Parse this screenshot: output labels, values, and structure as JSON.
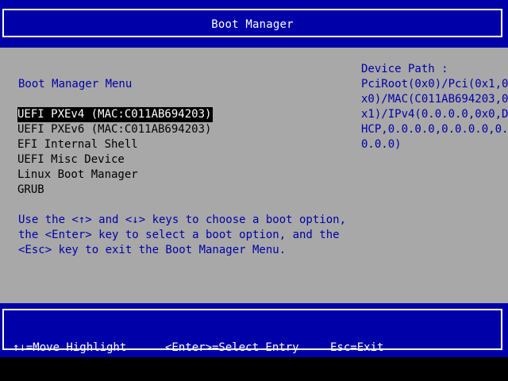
{
  "header": {
    "title": "Boot Manager"
  },
  "menu": {
    "heading": "Boot Manager Menu",
    "items": [
      {
        "label": "UEFI PXEv4 (MAC:C011AB694203)",
        "selected": true
      },
      {
        "label": "UEFI PXEv6 (MAC:C011AB694203)",
        "selected": false
      },
      {
        "label": "EFI Internal Shell",
        "selected": false
      },
      {
        "label": "UEFI Misc Device",
        "selected": false
      },
      {
        "label": "Linux Boot Manager",
        "selected": false
      },
      {
        "label": "GRUB",
        "selected": false
      }
    ]
  },
  "help": {
    "lines": [
      "Use the <↑> and <↓> keys to choose a boot option,",
      "the <Enter> key to select a boot option, and the",
      "<Esc> key to exit the Boot Manager Menu."
    ]
  },
  "device_path": {
    "label": "Device Path :",
    "lines": [
      "PciRoot(0x0)/Pci(0x1,0",
      "x0)/MAC(C011AB694203,0",
      "x1)/IPv4(0.0.0.0,0x0,D",
      "HCP,0.0.0.0,0.0.0.0,0.",
      "0.0.0)"
    ]
  },
  "status_bar": {
    "move": "↑↓=Move Highlight",
    "select": "<Enter>=Select Entry",
    "exit": "Esc=Exit"
  },
  "colors": {
    "band": "#0000a8",
    "panel": "#a8a8a8",
    "text_blue": "#0000a8",
    "highlight_bg": "#000000",
    "highlight_fg": "#ffffff"
  }
}
